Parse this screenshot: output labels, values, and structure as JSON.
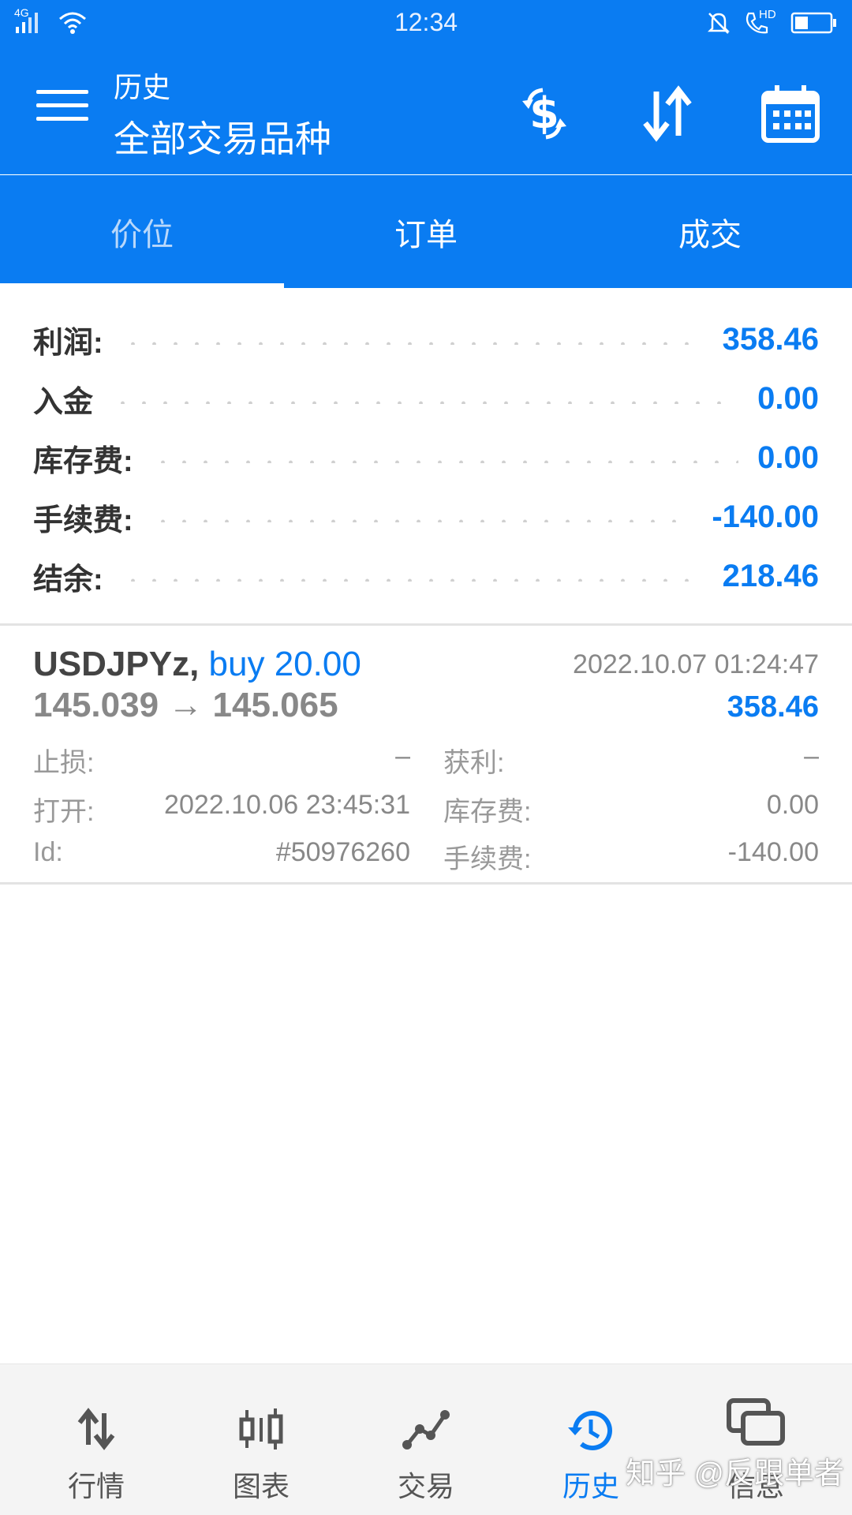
{
  "status_bar": {
    "network": "4G",
    "time": "12:34",
    "hd_label": "HD"
  },
  "appbar": {
    "title_small": "历史",
    "title_large": "全部交易品种",
    "actions": [
      "currency-exchange-icon",
      "sort-icon",
      "calendar-icon"
    ]
  },
  "tabs": [
    {
      "label": "价位",
      "active": true
    },
    {
      "label": "订单",
      "active": false
    },
    {
      "label": "成交",
      "active": false
    }
  ],
  "summary": [
    {
      "label": "利润:",
      "value": "358.46"
    },
    {
      "label": "入金",
      "value": "0.00"
    },
    {
      "label": "库存费:",
      "value": "0.00"
    },
    {
      "label": "手续费:",
      "value": "-140.00"
    },
    {
      "label": "结余:",
      "value": "218.46"
    }
  ],
  "deal": {
    "symbol": "USDJPYz,",
    "action": "buy 20.00",
    "close_time": "2022.10.07 01:24:47",
    "prices": "145.039 → 145.065",
    "profit": "358.46",
    "stop_loss_label": "止损:",
    "stop_loss_value": "–",
    "take_profit_label": "获利:",
    "take_profit_value": "–",
    "open_label": "打开:",
    "open_value": "2022.10.06 23:45:31",
    "swap_label": "库存费:",
    "swap_value": "0.00",
    "id_label": "Id:",
    "id_value": "#50976260",
    "commission_label": "手续费:",
    "commission_value": "-140.00"
  },
  "bottom_nav": [
    {
      "label": "行情",
      "icon": "quotes-arrows-icon",
      "active": false
    },
    {
      "label": "图表",
      "icon": "candlestick-chart-icon",
      "active": false
    },
    {
      "label": "交易",
      "icon": "trade-line-icon",
      "active": false
    },
    {
      "label": "历史",
      "icon": "history-clock-icon",
      "active": true
    },
    {
      "label": "信息",
      "icon": "messages-icon",
      "active": false
    }
  ],
  "watermark": "知乎 @反跟单者",
  "colors": {
    "primary": "#0a7cf2",
    "text_dark": "#333333",
    "text_gray": "#888888"
  }
}
